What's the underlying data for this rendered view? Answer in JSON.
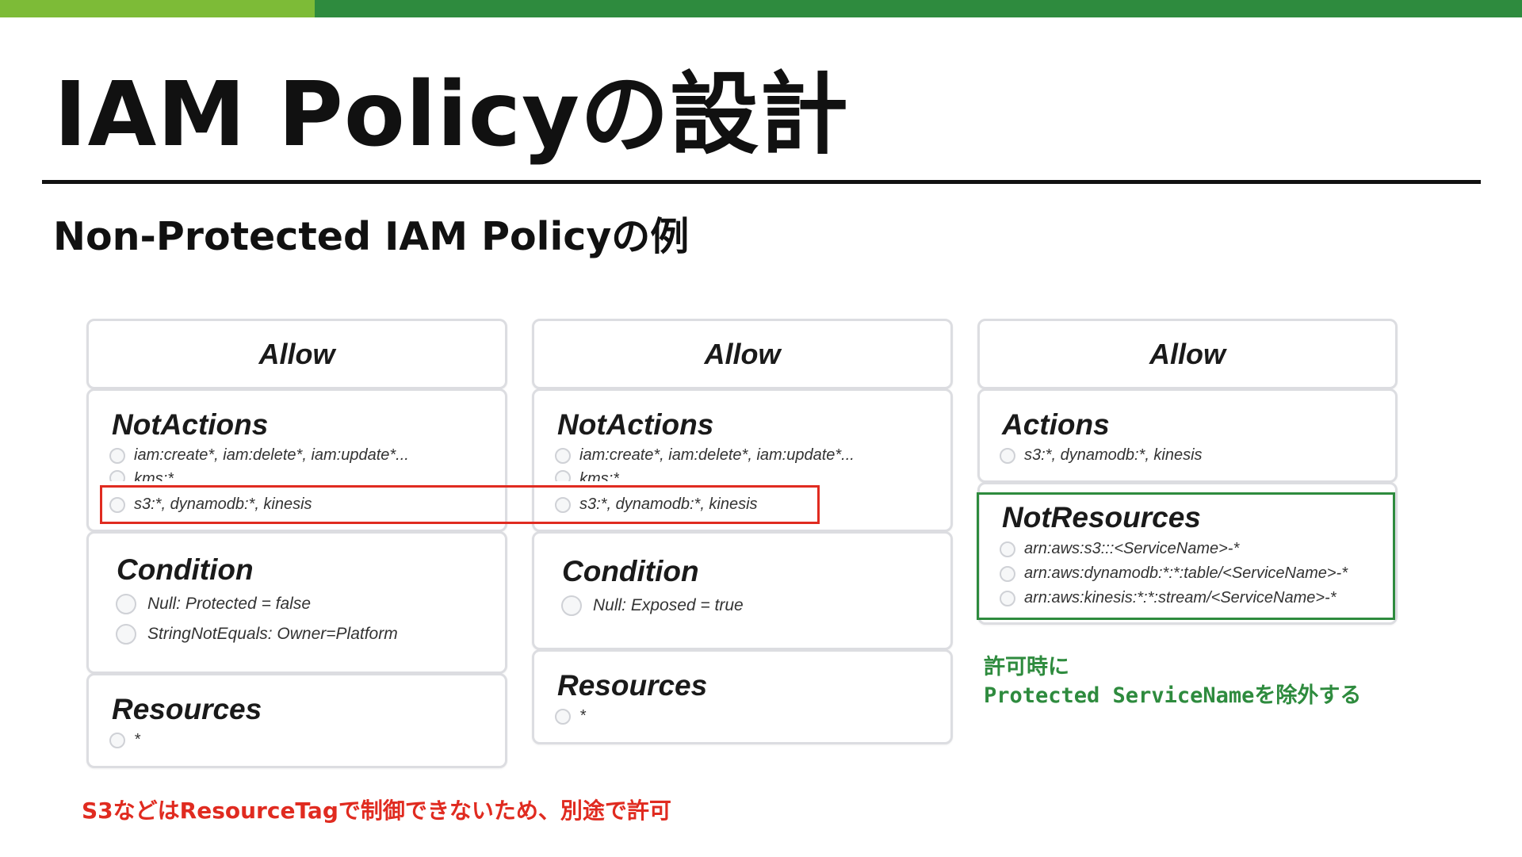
{
  "slide": {
    "title": "IAM Policyの設計",
    "subtitle": "Non-Protected IAM Policyの例"
  },
  "colors": {
    "accent_light_green": "#7dbb37",
    "accent_dark_green": "#2e8b3e",
    "highlight_red": "#e02b20",
    "highlight_green": "#2e8b3e"
  },
  "policies": [
    {
      "effect": "Allow",
      "actions_title": "NotActions",
      "actions": [
        "iam:create*, iam:delete*, iam:update*...",
        "kms:*",
        "s3:*, dynamodb:*, kinesis"
      ],
      "condition_title": "Condition",
      "conditions": [
        "Null: Protected = false",
        "StringNotEquals: Owner=Platform"
      ],
      "resources_title": "Resources",
      "resources": [
        "*"
      ]
    },
    {
      "effect": "Allow",
      "actions_title": "NotActions",
      "actions": [
        "iam:create*, iam:delete*, iam:update*...",
        "kms:*",
        "s3:*, dynamodb:*, kinesis"
      ],
      "condition_title": "Condition",
      "conditions": [
        "Null: Exposed = true"
      ],
      "resources_title": "Resources",
      "resources": [
        "*"
      ]
    },
    {
      "effect": "Allow",
      "actions_title": "Actions",
      "actions": [
        "s3:*, dynamodb:*, kinesis"
      ],
      "resources_title": "NotResources",
      "resources": [
        "arn:aws:s3:::<ServiceName>-*",
        "arn:aws:dynamodb:*:*:table/<ServiceName>-*",
        "arn:aws:kinesis:*:*:stream/<ServiceName>-*"
      ]
    }
  ],
  "notes": {
    "green_line1": "許可時に",
    "green_line2": "Protected ServiceNameを除外する",
    "red": "S3などはResourceTagで制御できないため、別途で許可"
  }
}
